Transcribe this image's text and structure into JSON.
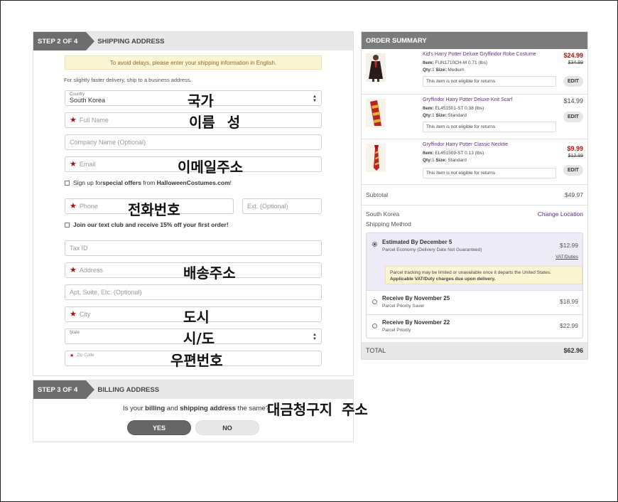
{
  "shipping": {
    "step": "STEP 2 OF 4",
    "title": "SHIPPING ADDRESS",
    "notice": "To avoid delays, please enter your shipping information in English.",
    "hint": "For slightly faster delivery, ship to a business address.",
    "country_label": "Country",
    "country_value": "South Korea",
    "full_name": "Full Name",
    "company": "Company Name (Optional)",
    "email": "Email",
    "offers_pre": "Sign up for ",
    "offers_bold": "special offers",
    "offers_mid": " from ",
    "offers_site": "HalloweenCostumes.com",
    "offers_end": "!",
    "phone": "Phone",
    "ext": "Ext. (Optional)",
    "text_club": "Join our text club and receive 15% off your first order!",
    "tax_id": "Tax ID",
    "address": "Address",
    "apt": "Apt, Suite, Etc. (Optional)",
    "city": "City",
    "state_label": "State",
    "zip": "Zip Code"
  },
  "annotations": {
    "country": "국가",
    "name": "이름 성",
    "email": "이메일주소",
    "phone": "전화번호",
    "address": "배송주소",
    "city": "도시",
    "state": "시/도",
    "zip": "우편번호",
    "billing": "대금청구지 주소"
  },
  "billing": {
    "step": "STEP 3 OF 4",
    "title": "BILLING ADDRESS",
    "q_pre": "Is your ",
    "q_b1": "billing",
    "q_mid": " and ",
    "q_b2": "shipping address",
    "q_end": " the same?",
    "yes": "YES",
    "no": "NO"
  },
  "order": {
    "title": "ORDER SUMMARY",
    "items": [
      {
        "name": "Kid's Harry Potter Deluxe Gryffindor Robe Costume",
        "item_label": "Item:",
        "item_code": "FUN1710CH-M",
        "weight": "0.71 (lbs)",
        "qty_label": "Qty:",
        "qty": "1",
        "size_label": "Size:",
        "size": "Medium",
        "returns": "This item is not eligible for returns",
        "price": "$24.99",
        "was": "$34.99",
        "edit": "EDIT"
      },
      {
        "name": "Gryffindor Harry Potter Deluxe Knit Scarf",
        "item_label": "Item:",
        "item_code": "EL451501-ST",
        "weight": "0.38 (lbs)",
        "qty_label": "Qty:",
        "qty": "1",
        "size_label": "Size:",
        "size": "Standard",
        "returns": "This item is not eligible for returns",
        "price": "$14.99",
        "was": "",
        "edit": "EDIT"
      },
      {
        "name": "Gryffindor Harry Potter Classic Necktie",
        "item_label": "Item:",
        "item_code": "EL451509-ST",
        "weight": "0.13 (lbs)",
        "qty_label": "Qty:",
        "qty": "1",
        "size_label": "Size:",
        "size": "Standard",
        "returns": "This item is not eligible for returns",
        "price": "$9.99",
        "was": "$12.99",
        "edit": "EDIT"
      }
    ],
    "subtotal_label": "Subtotal",
    "subtotal": "$49.97",
    "country": "South Korea",
    "change_location": "Change Location",
    "shipping_method": "Shipping Method",
    "options": [
      {
        "title": "Estimated By December 5",
        "sub": "Parcel Economy (Delivery Date Not Guaranteed)",
        "price": "$12.99",
        "vat": "VAT/Duties",
        "selected": true
      },
      {
        "title": "Receive By November 25",
        "sub": "Parcel Priority Saver",
        "price": "$18.99",
        "selected": false
      },
      {
        "title": "Receive By November 22",
        "sub": "Parcel Priority",
        "price": "$22.99",
        "selected": false
      }
    ],
    "vat_note_1": "Parcel tracking may be limited or unavailable once it departs the United States.",
    "vat_note_2": "Applicable VAT/Duty charges due upon delivery.",
    "total_label": "TOTAL",
    "total": "$62.96"
  },
  "colors": {
    "accent_purple": "#6a2a8a",
    "sale_red": "#aa1111",
    "notice_yellow": "#fcf5d3",
    "header_gray": "#7b7b7b"
  }
}
